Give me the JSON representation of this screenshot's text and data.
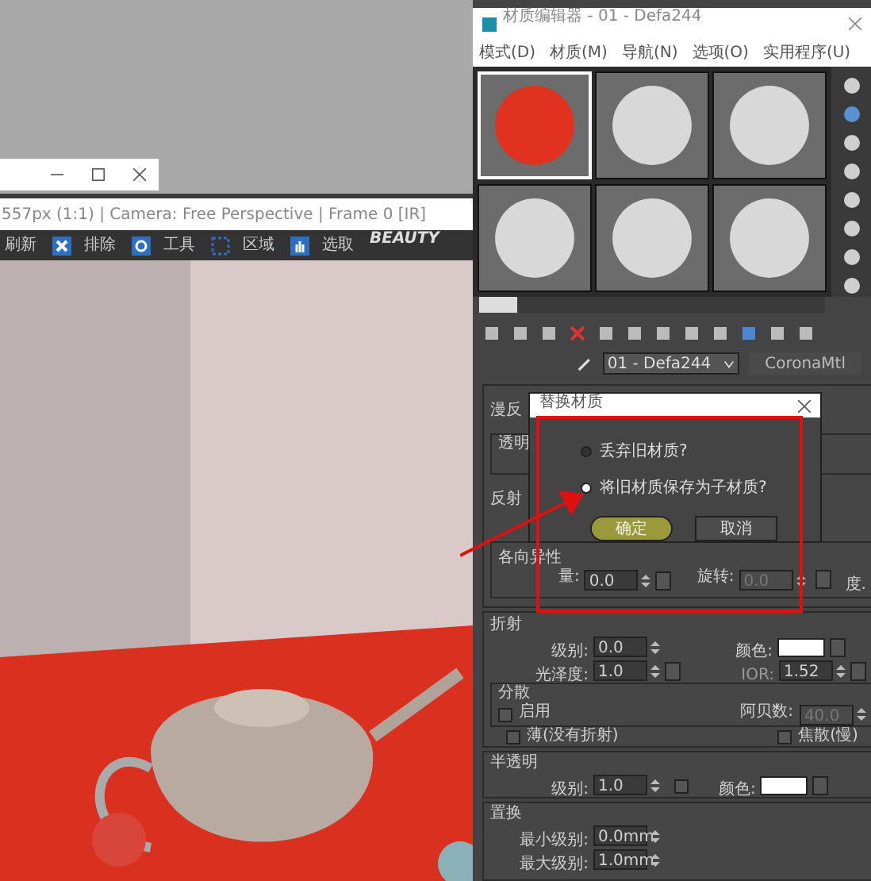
{
  "render_window": {
    "info_bar": "557px (1:1) | Camera: Free Perspective | Frame 0 [IR]",
    "toolbar": [
      "刷新",
      "排除",
      "工具",
      "区域",
      "选取"
    ],
    "pass_label": "BEAUTY"
  },
  "material_editor": {
    "title": "材质编辑器 - 01 - Defa244",
    "menu": [
      "模式(D)",
      "材质(M)",
      "导航(N)",
      "选项(O)",
      "实用程序(U)"
    ],
    "slots": [
      {
        "color": "#e0321e",
        "selected": true
      },
      {
        "color": "#d8d8d8",
        "selected": false
      },
      {
        "color": "#d8d8d8",
        "selected": false
      },
      {
        "color": "#d8d8d8",
        "selected": false
      },
      {
        "color": "#d8d8d8",
        "selected": false
      },
      {
        "color": "#d8d8d8",
        "selected": false
      }
    ],
    "material_name": "01 - Defa244",
    "material_type": "CoronaMtl",
    "covered": {
      "diffuse_label": "漫反",
      "opacity_label": "透明",
      "reflection_label": "反射",
      "anisotropy_label": "各向异性",
      "amount_label": "量:",
      "amount": "0.0",
      "rotation_label": "旋转:",
      "rotation": "0.0",
      "unit": "度."
    },
    "refraction": {
      "title": "折射",
      "level_label": "级别:",
      "level": "0.0",
      "color_label": "颜色:",
      "glossiness_label": "光泽度:",
      "glossiness": "1.0",
      "ior_label": "IOR:",
      "ior": "1.52",
      "dispersion": {
        "title": "分散",
        "enable_label": "启用",
        "enabled": false,
        "abbe_label": "阿贝数:",
        "abbe": "40.0"
      },
      "thin_label": "薄(没有折射)",
      "thin": false,
      "caustics_label": "焦散(慢)",
      "caustics": false
    },
    "translucency": {
      "title": "半透明",
      "level_label": "级别:",
      "level": "1.0",
      "checked": false,
      "color_label": "颜色:"
    },
    "displacement": {
      "title": "置换",
      "min_label": "最小级别:",
      "min": "0.0mm",
      "max_label": "最大级别:",
      "max": "1.0mm"
    }
  },
  "dialog": {
    "title": "替换材质",
    "options": [
      {
        "label": "丢弃旧材质?",
        "selected": false
      },
      {
        "label": "将旧材质保存为子材质?",
        "selected": true
      }
    ],
    "buttons": [
      {
        "label": "确定",
        "clicked": true
      },
      {
        "label": "取消",
        "clicked": false
      }
    ]
  }
}
